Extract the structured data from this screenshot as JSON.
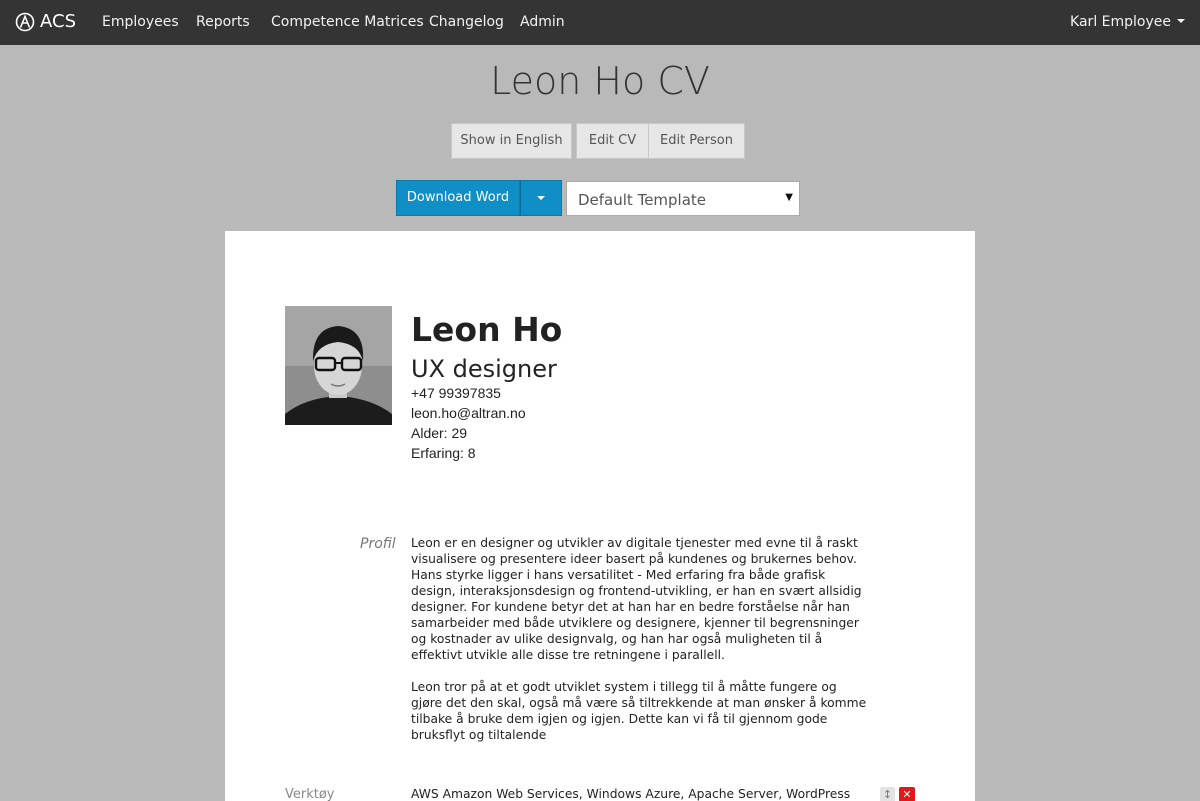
{
  "nav": {
    "brand": "ACS",
    "links": [
      "Employees",
      "Reports",
      "Competence Matrices",
      "Changelog",
      "Admin"
    ],
    "user": "Karl Employee"
  },
  "page_title": "Leon Ho CV",
  "buttons": {
    "show_english": "Show in English",
    "edit_cv": "Edit CV",
    "edit_person": "Edit Person",
    "download_word": "Download Word"
  },
  "template_select": {
    "value": "Default Template"
  },
  "cv": {
    "name": "Leon Ho",
    "role": "UX designer",
    "phone": "+47 99397835",
    "email": "leon.ho@altran.no",
    "age": "Alder: 29",
    "experience": "Erfaring: 8",
    "profile_label": "Profil",
    "profile_p1": "Leon er en designer og utvikler av digitale tjenester med evne til å raskt visualisere og presentere ideer basert på kundenes og brukernes behov. Hans styrke ligger i hans versatilitet - Med erfaring fra både grafisk design, interaksjonsdesign og frontend-utvikling, er han en svært allsidig designer. For kundene betyr det at han har en bedre forståelse når han samarbeider med både utviklere og designere, kjenner til begrensninger og kostnader av ulike designvalg, og han har også muligheten til å effektivt utvikle alle disse tre retningene i parallell.",
    "profile_p2": "Leon tror på at et godt utviklet system i tillegg til å måtte fungere og gjøre det den skal, også må være så tiltrekkende at man ønsker å komme tilbake å bruke dem igjen og igjen. Dette kan vi få til gjennom gode bruksflyt og tiltalende",
    "tools_label": "Verktøy",
    "tools_value": "AWS Amazon Web Services, Windows Azure, Apache Server, WordPress"
  }
}
